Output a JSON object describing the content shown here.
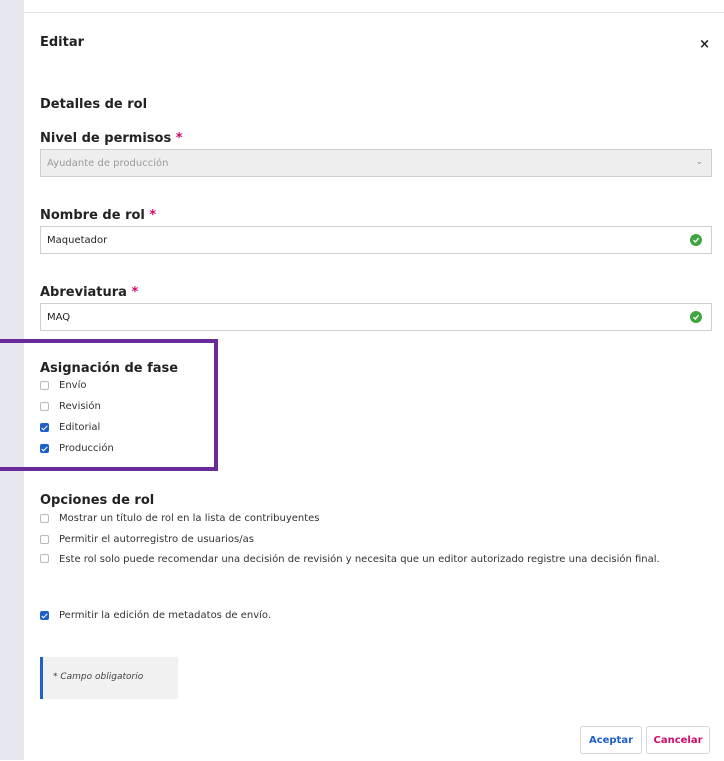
{
  "dialog": {
    "title": "Editar",
    "close_label": "×"
  },
  "role_details": {
    "section_title": "Detalles de rol",
    "required_mark": "*",
    "permission_level": {
      "label": "Nivel de permisos",
      "value": "Ayudante de producción"
    },
    "role_name": {
      "label": "Nombre de rol",
      "value": "Maquetador"
    },
    "abbreviation": {
      "label": "Abreviatura",
      "value": "MAQ"
    }
  },
  "stage_assignment": {
    "title": "Asignación de fase",
    "items": [
      {
        "label": "Envío",
        "checked": false
      },
      {
        "label": "Revisión",
        "checked": false
      },
      {
        "label": "Editorial",
        "checked": true
      },
      {
        "label": "Producción",
        "checked": true
      }
    ]
  },
  "role_options": {
    "title": "Opciones de rol",
    "items": [
      {
        "label": "Mostrar un título de rol en la lista de contribuyentes",
        "checked": false
      },
      {
        "label": "Permitir el autorregistro de usuarios/as",
        "checked": false
      },
      {
        "label": "Este rol solo puede recomendar una decisión de revisión y necesita que un editor autorizado registre una decisión final.",
        "checked": false
      },
      {
        "label": "Permitir la edición de metadatos de envío.",
        "checked": true
      }
    ]
  },
  "note": {
    "text": "* Campo obligatorio"
  },
  "buttons": {
    "accept": "Aceptar",
    "cancel": "Cancelar"
  },
  "colors": {
    "accent_blue": "#1f5fc9",
    "required_pink": "#d00a6c",
    "valid_green": "#3ea540",
    "highlight_purple": "#6a2b9a"
  }
}
